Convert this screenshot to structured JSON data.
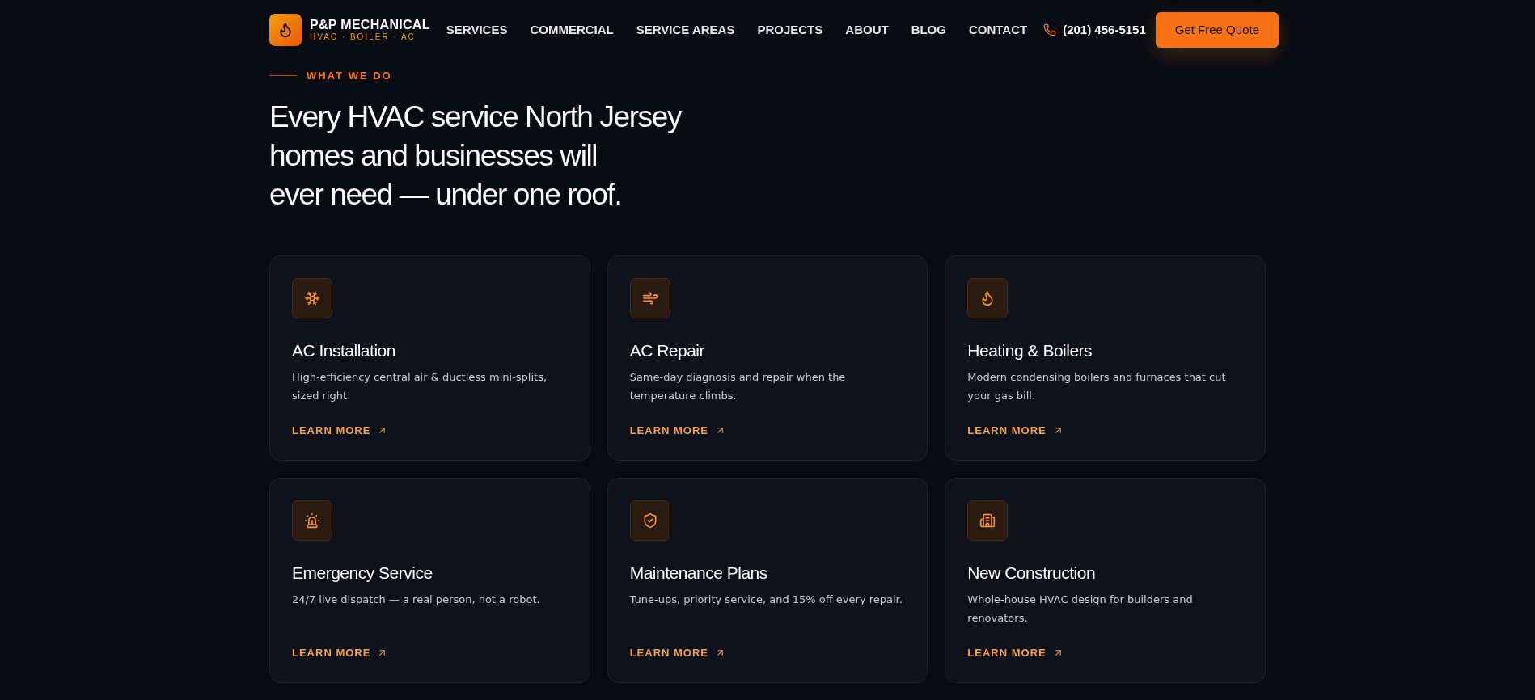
{
  "brand": {
    "name": "P&P MECHANICAL",
    "tagline": "HVAC · BOILER · AC"
  },
  "nav": [
    "SERVICES",
    "COMMERCIAL",
    "SERVICE AREAS",
    "PROJECTS",
    "ABOUT",
    "BLOG",
    "CONTACT"
  ],
  "phone": "(201) 456-5151",
  "cta": "Get Free Quote",
  "eyebrow": "WHAT WE DO",
  "heading_lines": [
    "Every HVAC service North Jersey",
    "homes and businesses will",
    "ever need — under one roof."
  ],
  "services": [
    {
      "title": "AC Installation",
      "description": "High-efficiency central air & ductless mini-splits, sized right.",
      "link": "LEARN MORE"
    },
    {
      "title": "AC Repair",
      "description": "Same-day diagnosis and repair when the temperature climbs.",
      "link": "LEARN MORE"
    },
    {
      "title": "Heating & Boilers",
      "description": "Modern condensing boilers and furnaces that cut your gas bill.",
      "link": "LEARN MORE"
    },
    {
      "title": "Emergency Service",
      "description": "24/7 live dispatch — a real person, not a robot.",
      "link": "LEARN MORE"
    },
    {
      "title": "Maintenance Plans",
      "description": "Tune-ups, priority service, and 15% off every repair.",
      "link": "LEARN MORE"
    },
    {
      "title": "New Construction",
      "description": "Whole-house HVAC design for builders and renovators.",
      "link": "LEARN MORE"
    }
  ]
}
